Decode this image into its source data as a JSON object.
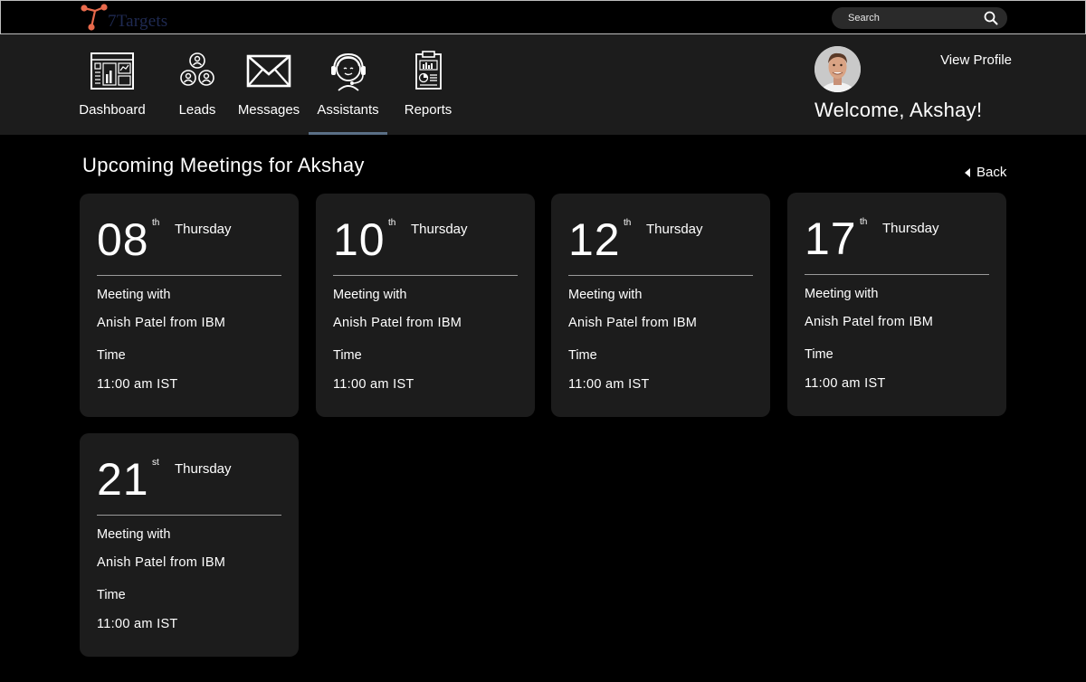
{
  "brand": {
    "name": "7Targets",
    "accent": "#e86a4c"
  },
  "search": {
    "placeholder": "Search"
  },
  "nav": {
    "items": [
      {
        "label": "Dashboard",
        "icon": "dashboard-icon"
      },
      {
        "label": "Leads",
        "icon": "leads-icon"
      },
      {
        "label": "Messages",
        "icon": "envelope-icon"
      },
      {
        "label": "Assistants",
        "icon": "headset-assistant-icon",
        "active": true
      },
      {
        "label": "Reports",
        "icon": "report-clipboard-icon"
      }
    ],
    "active_indicator_color": "#5a6f86"
  },
  "profile": {
    "view_profile": "View Profile",
    "welcome": "Welcome, Akshay!"
  },
  "main": {
    "title": "Upcoming Meetings for Akshay",
    "back_label": "Back",
    "meetings": [
      {
        "day": "08",
        "suffix": "th",
        "weekday": "Thursday",
        "meeting_label": "Meeting with",
        "with": "Anish Patel from IBM",
        "time_label": "Time",
        "time": "11:00 am IST"
      },
      {
        "day": "10",
        "suffix": "th",
        "weekday": "Thursday",
        "meeting_label": "Meeting with",
        "with": "Anish Patel from IBM",
        "time_label": "Time",
        "time": "11:00 am IST"
      },
      {
        "day": "12",
        "suffix": "th",
        "weekday": "Thursday",
        "meeting_label": "Meeting with",
        "with": "Anish Patel from IBM",
        "time_label": "Time",
        "time": "11:00 am IST"
      },
      {
        "day": "17",
        "suffix": "th",
        "weekday": "Thursday",
        "meeting_label": "Meeting with",
        "with": "Anish Patel from IBM",
        "time_label": "Time",
        "time": "11:00 am IST"
      },
      {
        "day": "21",
        "suffix": "st",
        "weekday": "Thursday",
        "meeting_label": "Meeting with",
        "with": "Anish Patel from IBM",
        "time_label": "Time",
        "time": "11:00 am IST"
      }
    ]
  }
}
